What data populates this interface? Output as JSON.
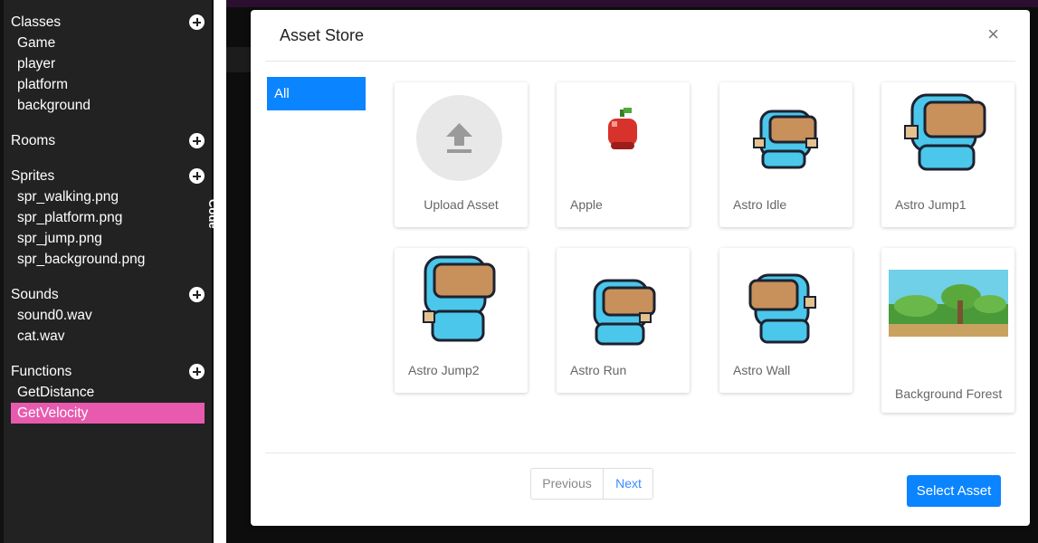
{
  "sidebar": {
    "classes": {
      "title": "Classes",
      "items": [
        "Game",
        "player",
        "platform",
        "background"
      ]
    },
    "rooms": {
      "title": "Rooms",
      "items": []
    },
    "sprites": {
      "title": "Sprites",
      "items": [
        "spr_walking.png",
        "spr_platform.png",
        "spr_jump.png",
        "spr_background.png"
      ]
    },
    "sounds": {
      "title": "Sounds",
      "items": [
        "sound0.wav",
        "cat.wav"
      ]
    },
    "functions": {
      "title": "Functions",
      "items": [
        "GetDistance",
        "GetVelocity"
      ],
      "active_index": 1
    },
    "vertical_tab": "Code"
  },
  "modal": {
    "title": "Asset Store",
    "close_label": "×",
    "categories": [
      "All"
    ],
    "assets": [
      {
        "label": "Upload Asset",
        "icon": "upload-icon"
      },
      {
        "label": "Apple",
        "icon": "apple-sprite"
      },
      {
        "label": "Astro Idle",
        "icon": "astro-sprite"
      },
      {
        "label": "Astro Jump1",
        "icon": "astro-sprite"
      },
      {
        "label": "Astro Jump2",
        "icon": "astro-sprite"
      },
      {
        "label": "Astro Run",
        "icon": "astro-sprite"
      },
      {
        "label": "Astro Wall",
        "icon": "astro-sprite"
      },
      {
        "label": "Background Forest",
        "icon": "forest-background"
      }
    ],
    "pagination": {
      "previous": "Previous",
      "next": "Next"
    },
    "select_button": "Select Asset"
  },
  "colors": {
    "accent": "#0a84ff",
    "active_item": "#e85aae",
    "sidebar_bg": "#222222"
  }
}
